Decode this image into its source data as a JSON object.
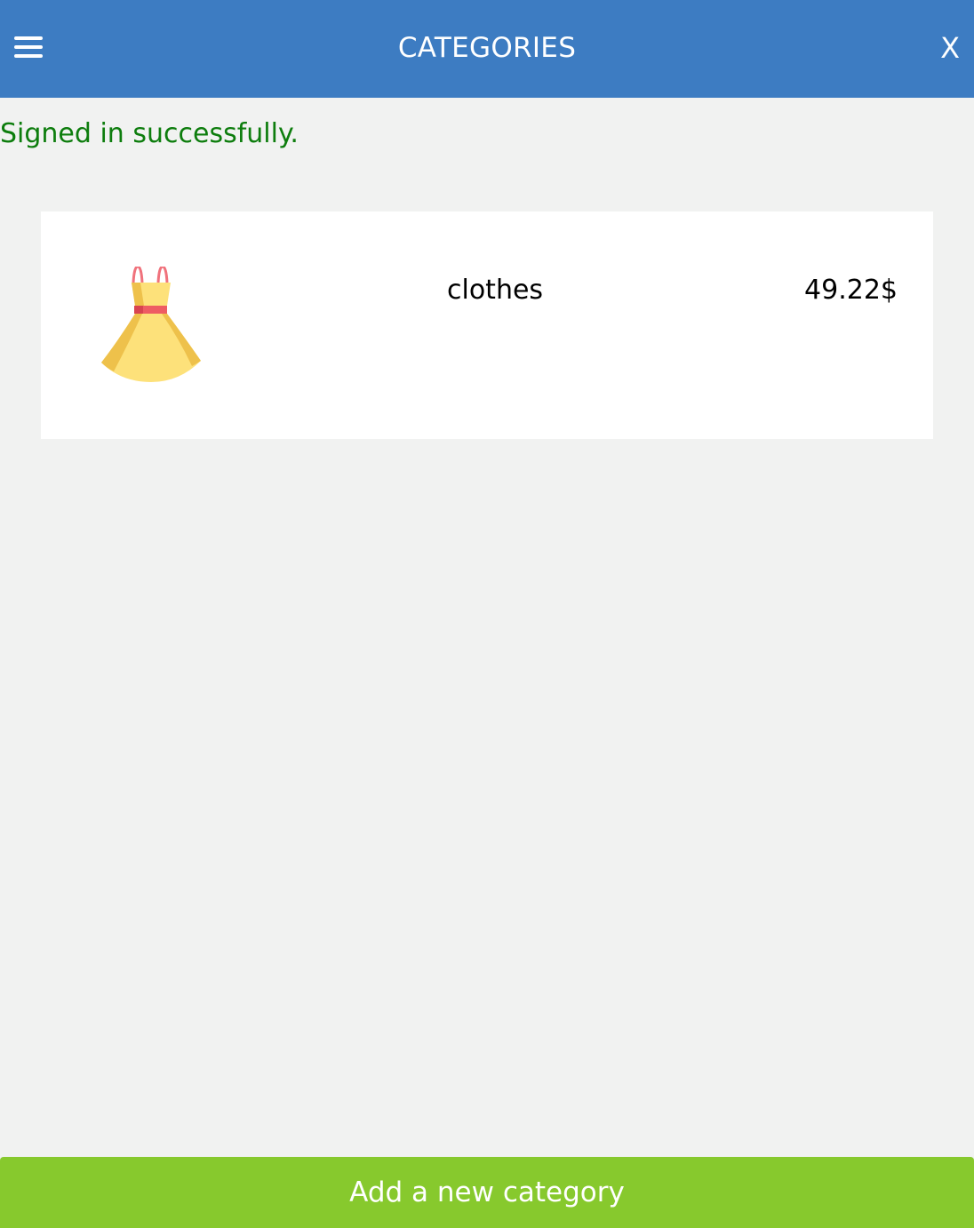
{
  "header": {
    "title": "CATEGORIES",
    "close_label": "X",
    "menu_icon": "hamburger-menu-icon",
    "background_color": "#3d7cc2"
  },
  "flash": {
    "message": "Signed in successfully.",
    "color": "#0d7d0d"
  },
  "categories": [
    {
      "name": "clothes",
      "price": "49.22$",
      "icon": "dress-icon"
    }
  ],
  "footer": {
    "add_label": "Add a new category",
    "background_color": "#87c92d"
  }
}
